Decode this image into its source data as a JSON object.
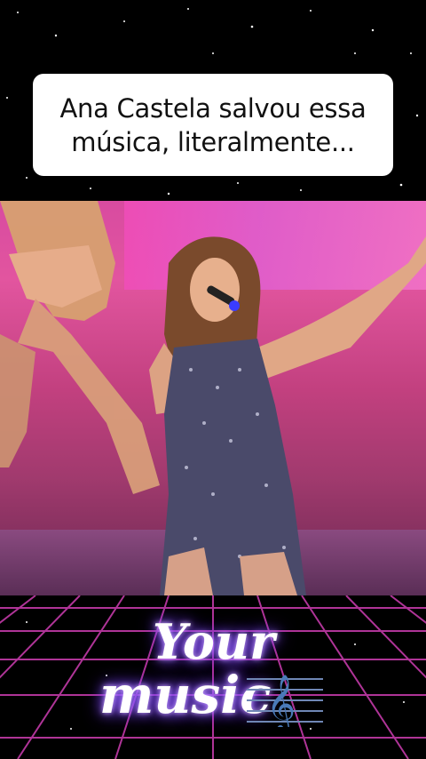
{
  "post": {
    "caption": "Ana Castela salvou essa música, literalmente..."
  },
  "logo": {
    "word1": "Your",
    "word2": "music",
    "icon": "treble-clef-icon"
  },
  "colors": {
    "caption_bg": "#ffffff",
    "stage_pink": "#e2559f",
    "grid_magenta": "#c23aa8",
    "logo_glow": "#8f5bff"
  }
}
